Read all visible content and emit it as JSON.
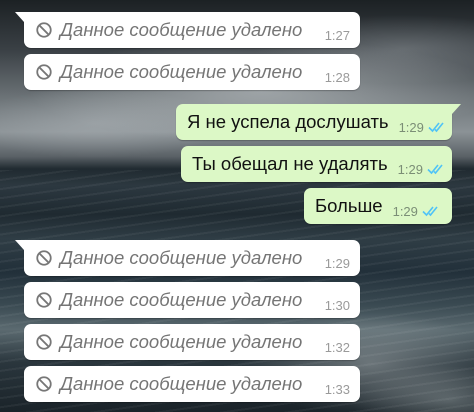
{
  "colors": {
    "incoming_bubble": "#ffffff",
    "outgoing_bubble": "#dcf8c6",
    "read_ticks": "#4fc3f7",
    "deleted_text": "#757575"
  },
  "icons": {
    "deleted": "ban-icon",
    "read_status": "double-check-icon"
  },
  "messages_top": [
    {
      "text": "Данное сообщение удалено",
      "time": "1:27"
    },
    {
      "text": "Данное сообщение удалено",
      "time": "1:28"
    }
  ],
  "messages_outgoing": [
    {
      "text": "Я не успела дослушать",
      "time": "1:29"
    },
    {
      "text": "Ты обещал не удалять",
      "time": "1:29"
    },
    {
      "text": "Больше",
      "time": "1:29"
    }
  ],
  "messages_bottom": [
    {
      "text": "Данное сообщение удалено",
      "time": "1:29"
    },
    {
      "text": "Данное сообщение удалено",
      "time": "1:30"
    },
    {
      "text": "Данное сообщение удалено",
      "time": "1:32"
    },
    {
      "text": "Данное сообщение удалено",
      "time": "1:33"
    }
  ]
}
